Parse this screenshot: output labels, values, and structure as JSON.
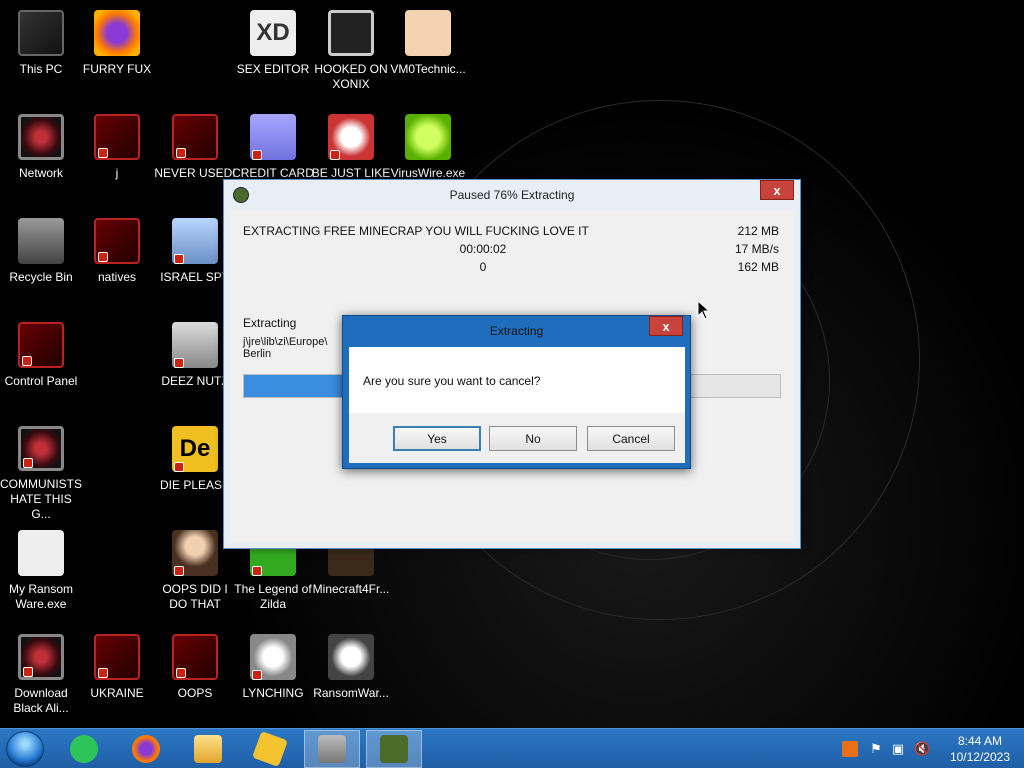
{
  "desktop": {
    "icons": [
      {
        "label": "This PC",
        "icon": "computer-icon"
      },
      {
        "label": "FURRY FUX",
        "icon": "firefox-icon"
      },
      {
        "label": "SEX EDITOR",
        "icon": "hxd-icon"
      },
      {
        "label": "HOOKED ON XONIX",
        "icon": "maze-game-icon"
      },
      {
        "label": "VM0Technic...",
        "icon": "doctor-icon"
      },
      {
        "label": "Network",
        "icon": "alien-icon"
      },
      {
        "label": "j",
        "icon": "red-shortcut-icon"
      },
      {
        "label": "NEVER USED!",
        "icon": "red-shortcut-icon"
      },
      {
        "label": "CREDIT CARD",
        "icon": "credit-card-icon"
      },
      {
        "label": "BE JUST LIKE",
        "icon": "santa-icon"
      },
      {
        "label": "VirusWire.exe",
        "icon": "lime-icon"
      },
      {
        "label": "Recycle Bin",
        "icon": "recycle-bin-icon"
      },
      {
        "label": "natives",
        "icon": "red-shortcut-icon"
      },
      {
        "label": "ISRAEL SPY",
        "icon": "network-computer-icon"
      },
      {
        "label": "Control Panel",
        "icon": "red-shortcut-icon"
      },
      {
        "label": "DEEZ NUTZ",
        "icon": "windows-stack-icon"
      },
      {
        "label": "COMMUNISTS HATE THIS G...",
        "icon": "alien-icon"
      },
      {
        "label": "DIE PLEASE",
        "icon": "de-icon"
      },
      {
        "label": "My Ransom Ware.exe",
        "icon": "ransomware-icon"
      },
      {
        "label": "OOPS DID I DO THAT",
        "icon": "painting-icon"
      },
      {
        "label": "The Legend of Zilda",
        "icon": "zilda-icon"
      },
      {
        "label": "Minecraft4Fr...",
        "icon": "minecraft-icon"
      },
      {
        "label": "Download Black Ali...",
        "icon": "alien-icon"
      },
      {
        "label": "UKRAINE",
        "icon": "red-shortcut-icon"
      },
      {
        "label": "OOPS",
        "icon": "red-shortcut-icon"
      },
      {
        "label": "LYNCHING",
        "icon": "rope-icon"
      },
      {
        "label": "RansomWar...",
        "icon": "skull-icon"
      }
    ]
  },
  "extract_window": {
    "title": "Paused 76% Extracting",
    "close_label": "x",
    "archive_name": "EXTRACTING FREE MINECRAP YOU WILL FUCKING LOVE IT",
    "elapsed": "00:00:02",
    "remaining": "0",
    "total_size": "212 MB",
    "speed": "17 MB/s",
    "processed": "162 MB",
    "status_label": "Extracting",
    "current_path": "j\\jre\\lib\\zi\\Europe\\ Berlin",
    "progress": 0.76
  },
  "confirm_dialog": {
    "title": "Extracting",
    "close_label": "x",
    "message": "Are you sure you want to cancel?",
    "yes_label": "Yes",
    "no_label": "No",
    "cancel_label": "Cancel"
  },
  "taskbar": {
    "apps": [
      "start-orb",
      "notes-icon",
      "firefox-icon",
      "file-explorer-icon",
      "sticky-icon",
      "castle-icon",
      "minecraft-icon"
    ],
    "active_app": "minecraft-icon"
  },
  "tray": {
    "time": "8:44 AM",
    "date": "10/12/2023"
  },
  "colors": {
    "taskbar": "#1f5fa6",
    "dialog_frame": "#1f6ebd",
    "progress_fill": "#3b8de0",
    "close_button": "#c7433b"
  }
}
